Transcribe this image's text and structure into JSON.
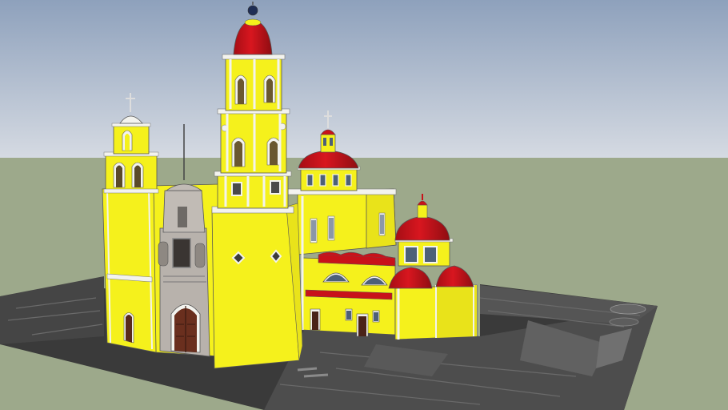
{
  "scene": {
    "description_free": true,
    "colors": {
      "sky_top": "#8fa2bd",
      "sky_bottom": "#d6dbe2",
      "ground": "#9ea98c",
      "plaza": "#3b3b3b",
      "plaza_light": "#5a5a5a",
      "facade_yellow": "#f6f21c",
      "facade_shadow": "#e9e21a",
      "dome_red": "#c8121a",
      "dome_dark": "#8e0d12",
      "stone_grey": "#b9b3ad",
      "stone_dark": "#6e6a66",
      "window_dark": "#2f2a28",
      "door_brown": "#6a2f1e",
      "trim_white": "#f3f3ee",
      "glass_blue": "#6d7f96"
    },
    "elements": {
      "left_tower": "bell-tower-left",
      "right_tower": "bell-tower-right",
      "main_dome": "main-dome",
      "rear_dome": "rear-dome",
      "facade": "church-facade",
      "nave": "church-nave",
      "plaza": "plaza-ground"
    }
  }
}
